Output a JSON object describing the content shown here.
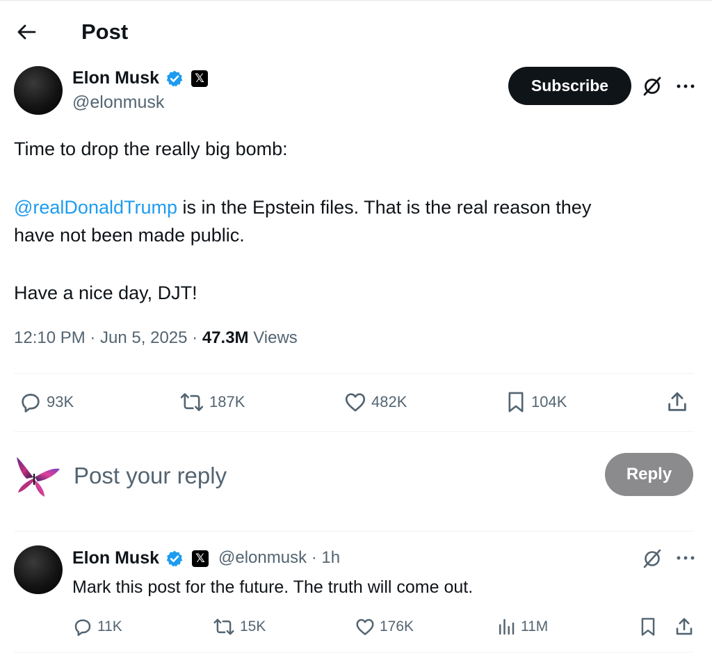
{
  "header": {
    "title": "Post"
  },
  "post": {
    "author_name": "Elon Musk",
    "author_handle": "@elonmusk",
    "subscribe_label": "Subscribe",
    "text_line1": "Time to drop the really big bomb:",
    "mention": "@realDonaldTrump",
    "text_line2_rest": " is in the Epstein files. That is the real reason they",
    "text_line3": "have not been made public.",
    "text_line4": "Have a nice day, DJT!",
    "timestamp": "12:10 PM · Jun 5, 2025 · ",
    "views_count": "47.3M",
    "views_label": " Views",
    "stats": {
      "replies": "93K",
      "reposts": "187K",
      "likes": "482K",
      "bookmarks": "104K"
    }
  },
  "composer": {
    "placeholder": "Post your reply",
    "reply_label": "Reply"
  },
  "reply": {
    "author_name": "Elon Musk",
    "handle_time": "@elonmusk · 1h",
    "text": "Mark this post for the future. The truth will come out.",
    "stats": {
      "replies": "11K",
      "reposts": "15K",
      "likes": "176K",
      "views": "11M"
    }
  },
  "colors": {
    "accent": "#1d9bf0",
    "text": "#0f1419",
    "secondary": "#536471",
    "reply_button_bg": "#8b8b8e"
  },
  "icons": [
    "back-arrow-icon",
    "verified-icon",
    "x-badge-icon",
    "grok-icon",
    "more-icon",
    "reply-icon",
    "repost-icon",
    "like-icon",
    "bookmark-icon",
    "share-icon",
    "views-icon",
    "butterfly-icon"
  ]
}
